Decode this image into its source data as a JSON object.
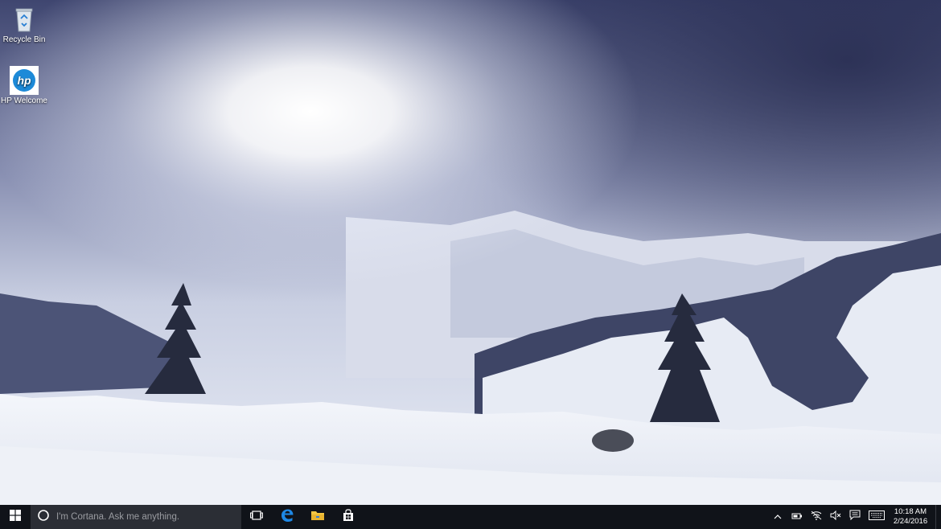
{
  "desktop": {
    "icons": [
      {
        "label": "Recycle Bin",
        "icon": "recycle-bin-icon"
      },
      {
        "label": "HP Welcome",
        "icon": "hp-logo-icon"
      }
    ],
    "wallpaper": "snowy-mountain-landscape"
  },
  "taskbar": {
    "start_icon": "windows-logo-icon",
    "search": {
      "placeholder": "I'm Cortana. Ask me anything."
    },
    "apps": [
      {
        "name": "Task View",
        "icon": "task-view-icon"
      },
      {
        "name": "Microsoft Edge",
        "icon": "edge-icon"
      },
      {
        "name": "File Explorer",
        "icon": "folder-icon"
      },
      {
        "name": "Store",
        "icon": "store-icon"
      }
    ],
    "tray": {
      "icons": [
        "chevron-up-icon",
        "battery-icon",
        "wifi-icon",
        "volume-muted-icon",
        "action-center-icon",
        "keyboard-icon"
      ],
      "time": "10:18 AM",
      "date": "2/24/2016"
    },
    "colors": {
      "background": "#101319",
      "search_box": "#2b2e35",
      "edge_blue": "#1e88e5",
      "folder_yellow": "#f4c542"
    }
  }
}
